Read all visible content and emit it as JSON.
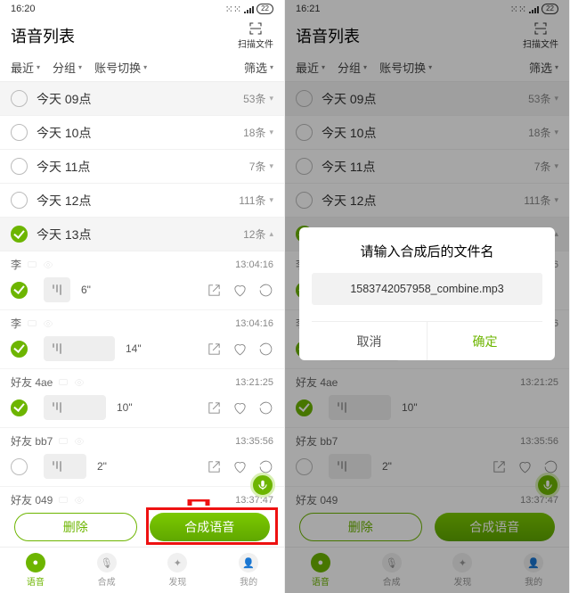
{
  "left": {
    "status": {
      "time": "16:20",
      "battery": "22"
    },
    "title": "语音列表",
    "scan_label": "扫描文件",
    "tabs": {
      "recent": "最近",
      "group": "分组",
      "account": "账号切换",
      "filter": "筛选"
    },
    "days": [
      {
        "label": "今天 09点",
        "count": "53条",
        "dim": true
      },
      {
        "label": "今天 10点",
        "count": "18条"
      },
      {
        "label": "今天 11点",
        "count": "7条"
      },
      {
        "label": "今天 12点",
        "count": "111条"
      },
      {
        "label": "今天 13点",
        "count": "12条",
        "sel": true,
        "exp": "▴"
      }
    ],
    "msgs": [
      {
        "name": "李",
        "ts": "13:04:16",
        "dur": "6\"",
        "on": true
      },
      {
        "name": "李",
        "ts": "13:04:16",
        "dur": "14\"",
        "on": true
      },
      {
        "name": "好友 4ae",
        "ts": "13:21:25",
        "dur": "10\"",
        "on": true
      },
      {
        "name": "好友 bb7",
        "ts": "13:35:56",
        "dur": "2\""
      },
      {
        "name": "好友 049",
        "ts": "13:37:47",
        "dur": ""
      }
    ],
    "actions": {
      "del": "删除",
      "go": "合成语音"
    },
    "nav": {
      "a": "语音",
      "b": "合成",
      "c": "发现",
      "d": "我的"
    }
  },
  "right": {
    "status": {
      "time": "16:21",
      "battery": "22"
    },
    "dialog": {
      "title": "请输入合成后的文件名",
      "value": "1583742057958_combine.mp3",
      "cancel": "取消",
      "ok": "确定"
    }
  }
}
